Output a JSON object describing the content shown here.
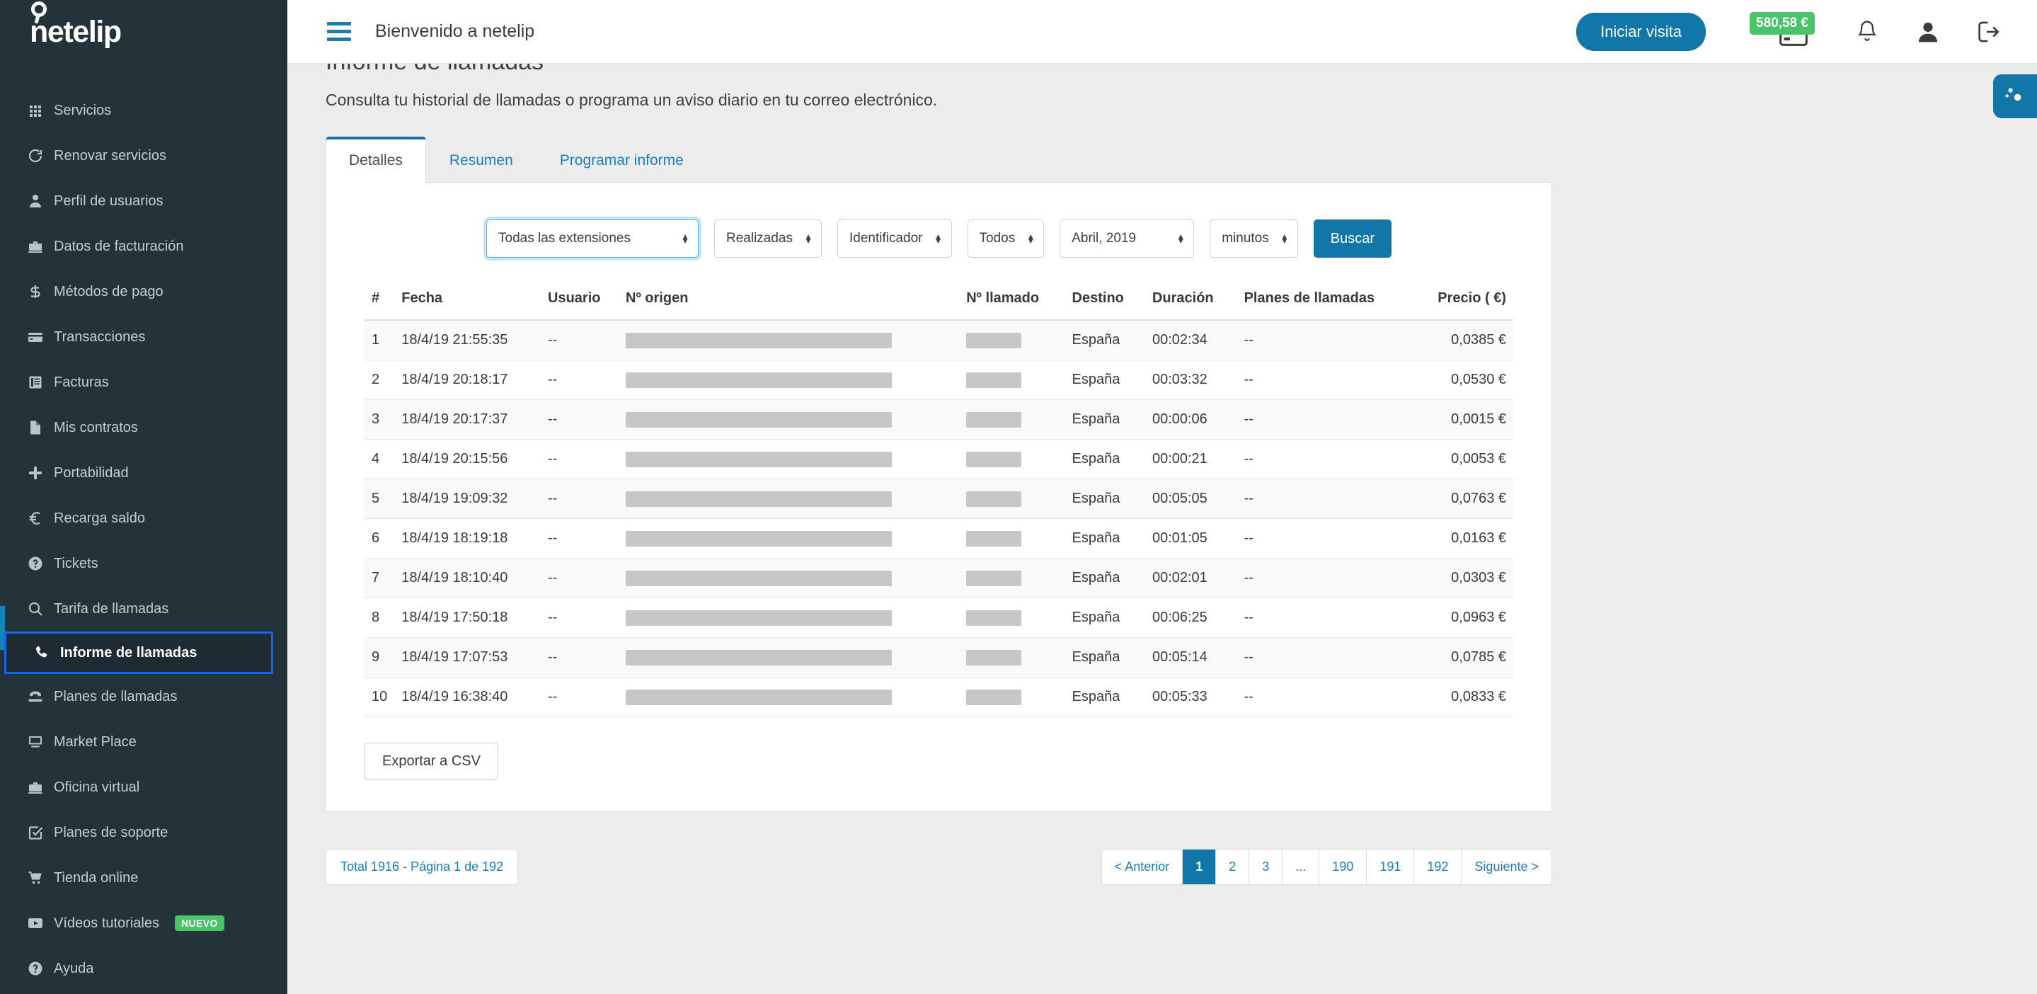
{
  "brand": {
    "name": "netelip"
  },
  "sidebar": {
    "items": [
      {
        "label": "Servicios",
        "icon": "grid-icon",
        "active": false
      },
      {
        "label": "Renovar servicios",
        "icon": "refresh-icon",
        "active": false
      },
      {
        "label": "Perfil de usuarios",
        "icon": "user-icon",
        "active": false
      },
      {
        "label": "Datos de facturación",
        "icon": "briefcase-icon",
        "active": false
      },
      {
        "label": "Métodos de pago",
        "icon": "dollar-icon",
        "active": false
      },
      {
        "label": "Transacciones",
        "icon": "credit-card-icon",
        "active": false
      },
      {
        "label": "Facturas",
        "icon": "invoice-icon",
        "active": false
      },
      {
        "label": "Mis contratos",
        "icon": "document-icon",
        "active": false
      },
      {
        "label": "Portabilidad",
        "icon": "plus-icon",
        "active": false
      },
      {
        "label": "Recarga saldo",
        "icon": "euro-icon",
        "active": false
      },
      {
        "label": "Tickets",
        "icon": "question-circle-icon",
        "active": false
      },
      {
        "label": "Tarifa de llamadas",
        "icon": "search-icon",
        "active": false
      },
      {
        "label": "Informe de llamadas",
        "icon": "phone-icon",
        "active": true
      },
      {
        "label": "Planes de llamadas",
        "icon": "telephone-icon",
        "active": false
      },
      {
        "label": "Market Place",
        "icon": "monitor-icon",
        "active": false
      },
      {
        "label": "Oficina virtual",
        "icon": "briefcase-icon",
        "active": false
      },
      {
        "label": "Planes de soporte",
        "icon": "check-square-icon",
        "active": false
      },
      {
        "label": "Tienda online",
        "icon": "cart-icon",
        "active": false
      },
      {
        "label": "Vídeos tutoriales",
        "icon": "video-icon",
        "active": false,
        "badge": "NUEVO"
      },
      {
        "label": "Ayuda",
        "icon": "question-circle-icon",
        "active": false
      }
    ]
  },
  "header": {
    "menu_icon": "hamburger-icon",
    "welcome": "Bienvenido a netelip",
    "visit_button": "Iniciar visita",
    "balance": "580,58 €",
    "card_icon": "credit-card-icon",
    "bell_icon": "bell-icon",
    "user_icon": "user-icon",
    "logout_icon": "logout-icon"
  },
  "float_tab": {
    "icon": "gears-icon"
  },
  "page": {
    "title": "Informe de llamadas",
    "subtitle": "Consulta tu historial de llamadas o programa un aviso diario en tu correo electrónico."
  },
  "tabs": [
    {
      "label": "Detalles",
      "active": true
    },
    {
      "label": "Resumen",
      "active": false
    },
    {
      "label": "Programar informe",
      "active": false
    }
  ],
  "filters": {
    "extension": "Todas las extensiones",
    "direction": "Realizadas",
    "identifier": "Identificador",
    "scope": "Todos",
    "month": "Abril, 2019",
    "unit": "minutos",
    "search_button": "Buscar"
  },
  "table": {
    "columns": [
      "#",
      "Fecha",
      "Usuario",
      "Nº origen",
      "Nº llamado",
      "Destino",
      "Duración",
      "Planes de llamadas",
      "Precio ( €)"
    ],
    "rows": [
      {
        "n": "1",
        "fecha": "18/4/19 21:55:35",
        "usuario": "--",
        "destino": "España",
        "duracion": "00:02:34",
        "planes": "--",
        "precio": "0,0385 €"
      },
      {
        "n": "2",
        "fecha": "18/4/19 20:18:17",
        "usuario": "--",
        "destino": "España",
        "duracion": "00:03:32",
        "planes": "--",
        "precio": "0,0530 €"
      },
      {
        "n": "3",
        "fecha": "18/4/19 20:17:37",
        "usuario": "--",
        "destino": "España",
        "duracion": "00:00:06",
        "planes": "--",
        "precio": "0,0015 €"
      },
      {
        "n": "4",
        "fecha": "18/4/19 20:15:56",
        "usuario": "--",
        "destino": "España",
        "duracion": "00:00:21",
        "planes": "--",
        "precio": "0,0053 €"
      },
      {
        "n": "5",
        "fecha": "18/4/19 19:09:32",
        "usuario": "--",
        "destino": "España",
        "duracion": "00:05:05",
        "planes": "--",
        "precio": "0,0763 €"
      },
      {
        "n": "6",
        "fecha": "18/4/19 18:19:18",
        "usuario": "--",
        "destino": "España",
        "duracion": "00:01:05",
        "planes": "--",
        "precio": "0,0163 €"
      },
      {
        "n": "7",
        "fecha": "18/4/19 18:10:40",
        "usuario": "--",
        "destino": "España",
        "duracion": "00:02:01",
        "planes": "--",
        "precio": "0,0303 €"
      },
      {
        "n": "8",
        "fecha": "18/4/19 17:50:18",
        "usuario": "--",
        "destino": "España",
        "duracion": "00:06:25",
        "planes": "--",
        "precio": "0,0963 €"
      },
      {
        "n": "9",
        "fecha": "18/4/19 17:07:53",
        "usuario": "--",
        "destino": "España",
        "duracion": "00:05:14",
        "planes": "--",
        "precio": "0,0785 €"
      },
      {
        "n": "10",
        "fecha": "18/4/19 16:38:40",
        "usuario": "--",
        "destino": "España",
        "duracion": "00:05:33",
        "planes": "--",
        "precio": "0,0833 €"
      }
    ]
  },
  "export_button": "Exportar a CSV",
  "footer": {
    "total": "Total 1916 - Página 1 de 192",
    "pages": [
      {
        "label": "< Anterior",
        "current": false
      },
      {
        "label": "1",
        "current": true
      },
      {
        "label": "2",
        "current": false
      },
      {
        "label": "3",
        "current": false
      },
      {
        "label": "...",
        "current": false
      },
      {
        "label": "190",
        "current": false
      },
      {
        "label": "191",
        "current": false
      },
      {
        "label": "192",
        "current": false
      },
      {
        "label": "Siguiente >",
        "current": false
      }
    ]
  },
  "colors": {
    "sidebar_bg": "#24333a",
    "accent_blue": "#1077a8",
    "focus_blue": "#1266e8",
    "badge_green": "#49c46a",
    "link_blue": "#1a7fbd"
  }
}
